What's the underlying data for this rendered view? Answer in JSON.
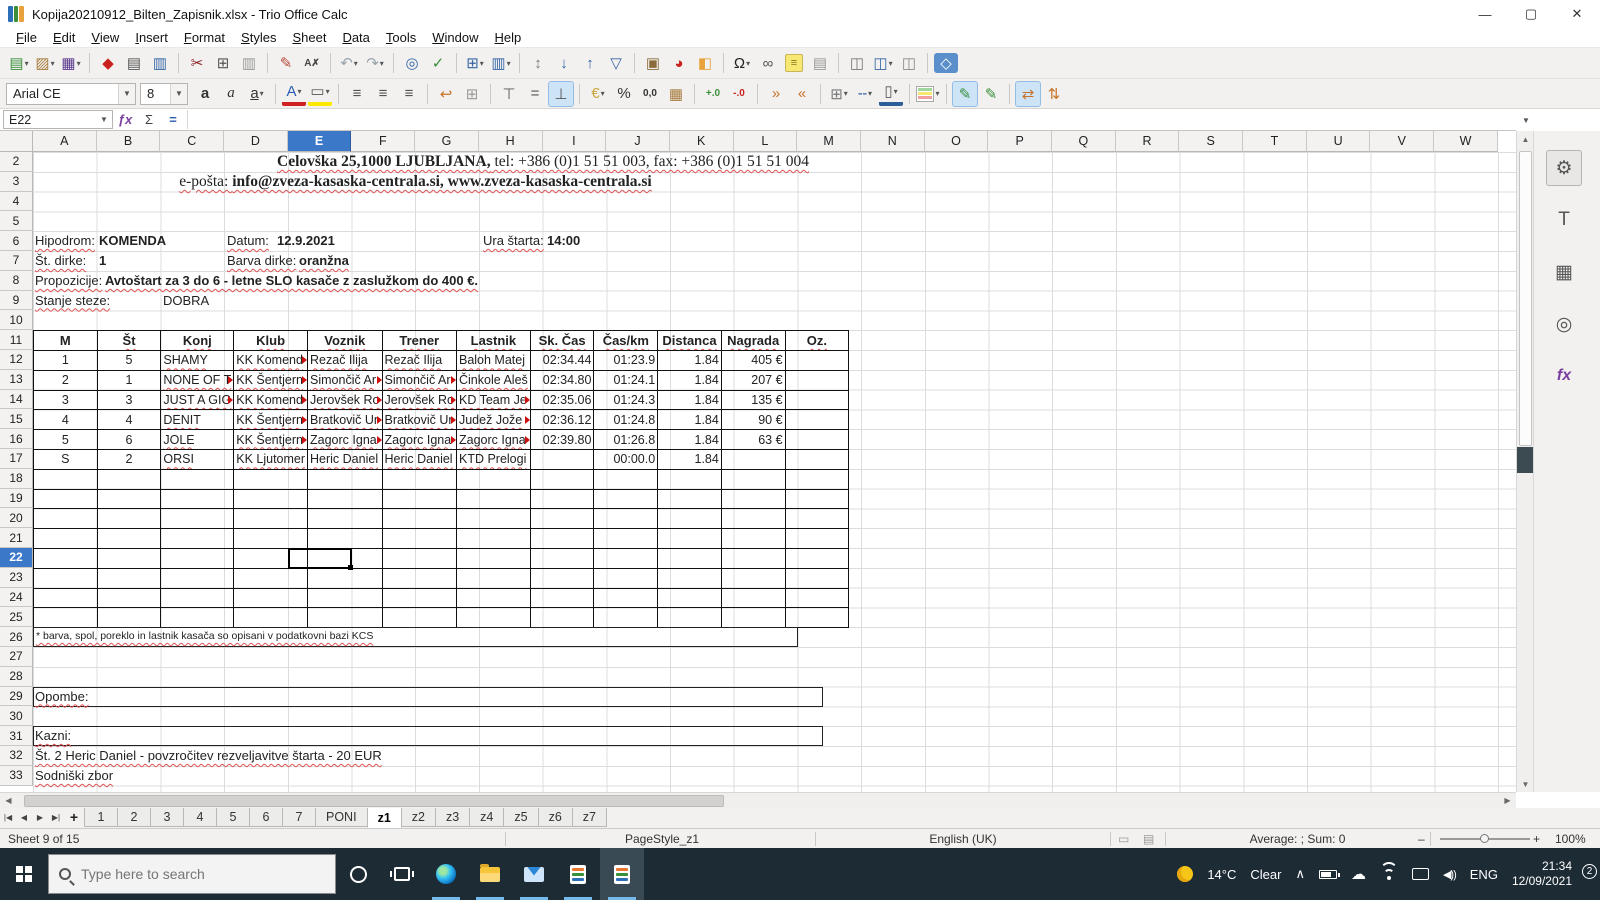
{
  "window": {
    "title": "Kopija20210912_Bilten_Zapisnik.xlsx - Trio Office Calc",
    "minimize": "—",
    "maximize": "▢",
    "close": "✕"
  },
  "menu": {
    "items": [
      "File",
      "Edit",
      "View",
      "Insert",
      "Format",
      "Styles",
      "Sheet",
      "Data",
      "Tools",
      "Window",
      "Help"
    ]
  },
  "colors": {
    "accent": "#3c78c8",
    "taskbar": "#1d2b35",
    "header_bg": "#f3f2f1",
    "grid_line": "#dcdcdc"
  },
  "toolbar_main": {
    "items": [
      {
        "n": "new-document-button",
        "g": "▤",
        "c": "#3a8f3a",
        "dd": 1
      },
      {
        "n": "open-button",
        "g": "▨",
        "c": "#a67c3d",
        "dd": 1
      },
      {
        "n": "save-button",
        "g": "▦",
        "c": "#5b3a8e",
        "dd": 1
      },
      {
        "sep": 1
      },
      {
        "n": "export-pdf-button",
        "g": "◆",
        "c": "#c9211e"
      },
      {
        "n": "print-button",
        "g": "▤",
        "c": "#555555"
      },
      {
        "n": "print-preview-button",
        "g": "▥",
        "c": "#3465a4"
      },
      {
        "sep": 1
      },
      {
        "n": "cut-button",
        "g": "✂",
        "c": "#8a1f1f"
      },
      {
        "n": "copy-button",
        "g": "⊞",
        "c": "#555555"
      },
      {
        "n": "paste-button",
        "g": "▥",
        "c": "#999999"
      },
      {
        "sep": 1
      },
      {
        "n": "clone-formatting-button",
        "g": "✎",
        "c": "#b84a3a"
      },
      {
        "n": "clear-formatting-button",
        "g": "A✗",
        "c": "#444444",
        "small": 1
      },
      {
        "sep": 1
      },
      {
        "n": "undo-button",
        "g": "↶",
        "c": "#9aa4ab",
        "dd": 1
      },
      {
        "n": "redo-button",
        "g": "↷",
        "c": "#9aa4ab",
        "dd": 1
      },
      {
        "sep": 1
      },
      {
        "n": "find-replace-button",
        "g": "◎",
        "c": "#3465a4"
      },
      {
        "n": "spelling-button",
        "g": "✓",
        "c": "#3a8f3a"
      },
      {
        "sep": 1
      },
      {
        "n": "insert-table-button",
        "g": "⊞",
        "c": "#3465a4",
        "dd": 1
      },
      {
        "n": "insert-column-button",
        "g": "▥",
        "c": "#3465a4",
        "dd": 1
      },
      {
        "sep": 1
      },
      {
        "n": "sort-button",
        "g": "↕",
        "c": "#777777"
      },
      {
        "n": "sort-ascending-button",
        "g": "↓",
        "c": "#3465a4"
      },
      {
        "n": "sort-descending-button",
        "g": "↑",
        "c": "#3465a4"
      },
      {
        "n": "autofilter-button",
        "g": "▽",
        "c": "#3465a4"
      },
      {
        "sep": 1
      },
      {
        "n": "insert-image-button",
        "g": "▣",
        "c": "#8a6d3b"
      },
      {
        "n": "insert-chart-button",
        "g": "◕",
        "c": "#c9211e"
      },
      {
        "n": "pivot-table-button",
        "g": "◧",
        "c": "#e8a33d"
      },
      {
        "sep": 1
      },
      {
        "n": "special-character-button",
        "g": "Ω",
        "c": "#222222",
        "dd": 1
      },
      {
        "n": "hyperlink-button",
        "g": "∞",
        "c": "#555555"
      },
      {
        "n": "comment-button",
        "g": "≡",
        "c": "#8a7a20",
        "note": 1
      },
      {
        "n": "headers-footers-button",
        "g": "▤",
        "c": "#999999"
      },
      {
        "sep": 1
      },
      {
        "n": "page-break-button",
        "g": "◫",
        "c": "#777777"
      },
      {
        "n": "freeze-panes-button",
        "g": "◫",
        "c": "#3465a4",
        "dd": 1
      },
      {
        "n": "split-window-button",
        "g": "◫",
        "c": "#888888"
      },
      {
        "sep": 1
      },
      {
        "n": "show-draw-functions-button",
        "g": "◇",
        "c": "#ffffff",
        "bluechip": 1
      }
    ]
  },
  "toolbar_format": {
    "font_name": "Arial CE",
    "font_size": "8",
    "items": [
      {
        "n": "bold-button",
        "g": "a",
        "c": "#333333",
        "style": "bold"
      },
      {
        "n": "italic-button",
        "g": "a",
        "c": "#333333",
        "style": "italic"
      },
      {
        "n": "underline-button",
        "g": "a",
        "c": "#333333",
        "style": "underline",
        "dd": 1
      },
      {
        "sep": 1
      },
      {
        "n": "font-color-button",
        "g": "A",
        "c": "#2a5db0",
        "ub": "ub-red",
        "dd": 1
      },
      {
        "n": "highlighting-color-button",
        "g": "▭",
        "c": "#555555",
        "ub": "ub-yellow",
        "dd": 1
      },
      {
        "sep": 1
      },
      {
        "n": "align-left-button",
        "g": "≡",
        "c": "#555555"
      },
      {
        "n": "align-center-button",
        "g": "≡",
        "c": "#555555"
      },
      {
        "n": "align-right-button",
        "g": "≡",
        "c": "#555555"
      },
      {
        "sep": 1
      },
      {
        "n": "wrap-text-button",
        "g": "↩",
        "c": "#c9732a"
      },
      {
        "n": "merge-cells-button",
        "g": "⊞",
        "c": "#999999"
      },
      {
        "sep": 1
      },
      {
        "n": "align-top-button",
        "g": "⊤",
        "c": "#555555"
      },
      {
        "n": "center-vertically-button",
        "g": "=",
        "c": "#555555"
      },
      {
        "n": "align-bottom-button",
        "g": "⊥",
        "c": "#555555",
        "act": 1
      },
      {
        "sep": 1
      },
      {
        "n": "currency-format-button",
        "g": "€",
        "c": "#caa53d",
        "dd": 1
      },
      {
        "n": "percent-format-button",
        "g": "%",
        "c": "#333333"
      },
      {
        "n": "number-format-button",
        "g": "0,0",
        "c": "#333333",
        "small": 1
      },
      {
        "n": "date-format-button",
        "g": "▦",
        "c": "#a67c3d"
      },
      {
        "sep": 1
      },
      {
        "n": "add-decimal-button",
        "g": "+.0",
        "c": "#3a8f3a",
        "small": 1
      },
      {
        "n": "delete-decimal-button",
        "g": "-.0",
        "c": "#c9211e",
        "small": 1
      },
      {
        "sep": 1
      },
      {
        "n": "increase-indent-button",
        "g": "»",
        "c": "#c9732a"
      },
      {
        "n": "decrease-indent-button",
        "g": "«",
        "c": "#c9732a"
      },
      {
        "sep": 1
      },
      {
        "n": "borders-button",
        "g": "⊞",
        "c": "#777777",
        "dd": 1
      },
      {
        "n": "border-style-button",
        "g": "╌",
        "c": "#3465a4",
        "dd": 1
      },
      {
        "n": "background-color-button",
        "g": "▯",
        "c": "#555555",
        "ub": "ub-blue",
        "dd": 1
      },
      {
        "sep": 1
      },
      {
        "n": "conditional-formatting-button",
        "cf": 1,
        "dd": 1
      },
      {
        "sep": 1
      },
      {
        "n": "left-to-right-button",
        "g": "✎",
        "c": "#3a8f3a",
        "act": 1
      },
      {
        "n": "right-to-left-button",
        "g": "✎",
        "c": "#3a8f3a"
      },
      {
        "sep": 1
      },
      {
        "n": "text-direction-horizontal-button",
        "g": "⇄",
        "c": "#c9732a",
        "act": 1
      },
      {
        "n": "text-direction-vertical-button",
        "g": "⇅",
        "c": "#c9732a"
      }
    ]
  },
  "formula_bar": {
    "cell_reference": "E22",
    "function_wizard": "ƒx",
    "sum": "Σ",
    "equals": "=",
    "formula": ""
  },
  "grid": {
    "columns": [
      "A",
      "B",
      "C",
      "D",
      "E",
      "F",
      "G",
      "H",
      "I",
      "J",
      "K",
      "L",
      "M",
      "N",
      "O",
      "P",
      "Q",
      "R",
      "S",
      "T",
      "U",
      "V",
      "W"
    ],
    "selected_column": "E",
    "row_start": 2,
    "row_end": 33,
    "selected_row": 22,
    "active_cell": "E22"
  },
  "sheet_content": {
    "address_line1_bold": "Celovška 25,1000 LJUBLJANA,",
    "address_line1_rest": " tel: +386 (0)1 51 51 003, fax: +386 (0)1 51 51 004",
    "address_line2_prefix": "e-pošta: ",
    "address_line2_bold": "info@zveza-kasaska-centrala.si, www.zveza-kasaska-centrala.si",
    "info": {
      "hipodrom_label": "Hipodrom:",
      "hipodrom": "KOMENDA",
      "datum_label": "Datum:",
      "datum": "12.9.2021",
      "ura_label": "Ura štarta:",
      "ura": "14:00",
      "st_dirke_label": "Št. dirke:",
      "st_dirke": "1",
      "barva_label": "Barva dirke:",
      "barva": "oranžna",
      "propozicije_label": "Propozicije:",
      "propozicije": "Avtoštart za 3 do 6 - letne SLO kasače z zaslužkom do 400 €.",
      "stanje_label": "Stanje steze:",
      "stanje": "DOBRA"
    },
    "footnote": "* barva, spol, poreklo in lastnik kasača so opisani v podatkovni bazi KCS",
    "opombe_label": "Opombe:",
    "kazni_label": "Kazni:",
    "kazni_line": "Št. 2 Heric Daniel - povzročitev rezveljavitve štarta - 20 EUR",
    "sodniski_label": "Sodniški zbor"
  },
  "table": {
    "headers": [
      "M",
      "Št",
      "Konj",
      "Klub",
      "Voznik",
      "Trener",
      "Lastnik",
      "Sk. Čas",
      "Čas/km",
      "Distanca",
      "Nagrada",
      "Oz."
    ],
    "align": [
      "c",
      "c",
      "l",
      "l",
      "l",
      "l",
      "l",
      "r",
      "r",
      "r",
      "r",
      "c"
    ],
    "rows": [
      {
        "c": [
          "1",
          "5",
          "SHAMY",
          "KK Komend",
          "Rezač Ilija",
          "Rezač Ilija",
          "Baloh Matej",
          "02:34.44",
          "01:23.9",
          "1.84",
          "405 €",
          ""
        ],
        "trunc": [
          3
        ]
      },
      {
        "c": [
          "2",
          "1",
          "NONE OF T",
          "KK Šentjern",
          "Simončič Ar",
          "Simončič Ar",
          "Činkole Aleš",
          "02:34.80",
          "01:24.1",
          "1.84",
          "207 €",
          ""
        ],
        "trunc": [
          2,
          3,
          4,
          5
        ]
      },
      {
        "c": [
          "3",
          "3",
          "JUST A GIG",
          "KK Komend",
          "Jerovšek Ro",
          "Jerovšek Ro",
          "KD Team Je",
          "02:35.06",
          "01:24.3",
          "1.84",
          "135 €",
          ""
        ],
        "trunc": [
          2,
          3,
          4,
          5,
          6
        ]
      },
      {
        "c": [
          "4",
          "4",
          "DENIT",
          "KK Šentjern",
          "Bratkovič Ur",
          "Bratkovič Ur",
          "Judež Jože",
          "02:36.12",
          "01:24.8",
          "1.84",
          "90 €",
          ""
        ],
        "trunc": [
          3,
          4,
          5,
          6
        ]
      },
      {
        "c": [
          "5",
          "6",
          "JOLE",
          "KK Šentjern",
          "Zagorc Igna",
          "Zagorc Igna",
          "Zagorc Igna",
          "02:39.80",
          "01:26.8",
          "1.84",
          "63 €",
          ""
        ],
        "trunc": [
          3,
          4,
          5,
          6
        ]
      },
      {
        "c": [
          "S",
          "2",
          "ORSI",
          "KK Ljutomer",
          "Heric Daniel",
          "Heric Daniel",
          "KTD Prelogi",
          "",
          "00:00.0",
          "1.84",
          "",
          ""
        ],
        "trunc": []
      }
    ],
    "empty_rows": 8
  },
  "sheet_tabs": {
    "nav": [
      "|◀",
      "◀",
      "▶",
      "▶|"
    ],
    "add": "+",
    "tabs": [
      "1",
      "2",
      "3",
      "4",
      "5",
      "6",
      "7",
      "PONI",
      "z1",
      "z2",
      "z3",
      "z4",
      "z5",
      "z6",
      "z7"
    ],
    "active": "z1"
  },
  "status_bar": {
    "sheet_info": "Sheet 9 of 15",
    "page_style": "PageStyle_z1",
    "language": "English (UK)",
    "avg_sum": "Average: ; Sum: 0",
    "zoom_level": "100%",
    "zoom_minus": "–",
    "zoom_plus": "+"
  },
  "sidebar": {
    "items": [
      {
        "n": "properties-panel-button",
        "g": "⚙",
        "sel": 1
      },
      {
        "n": "styles-panel-button",
        "g": "T"
      },
      {
        "n": "gallery-panel-button",
        "g": "▦"
      },
      {
        "n": "navigator-panel-button",
        "g": "◎"
      },
      {
        "n": "functions-panel-button",
        "g": "fx",
        "fx": 1
      }
    ]
  },
  "taskbar": {
    "search_placeholder": "Type here to search",
    "weather_temp": "14°C",
    "weather_desc": "Clear",
    "chevron": "∧",
    "lang": "ENG",
    "time": "21:34",
    "date": "12/09/2021",
    "notification_count": "2"
  }
}
